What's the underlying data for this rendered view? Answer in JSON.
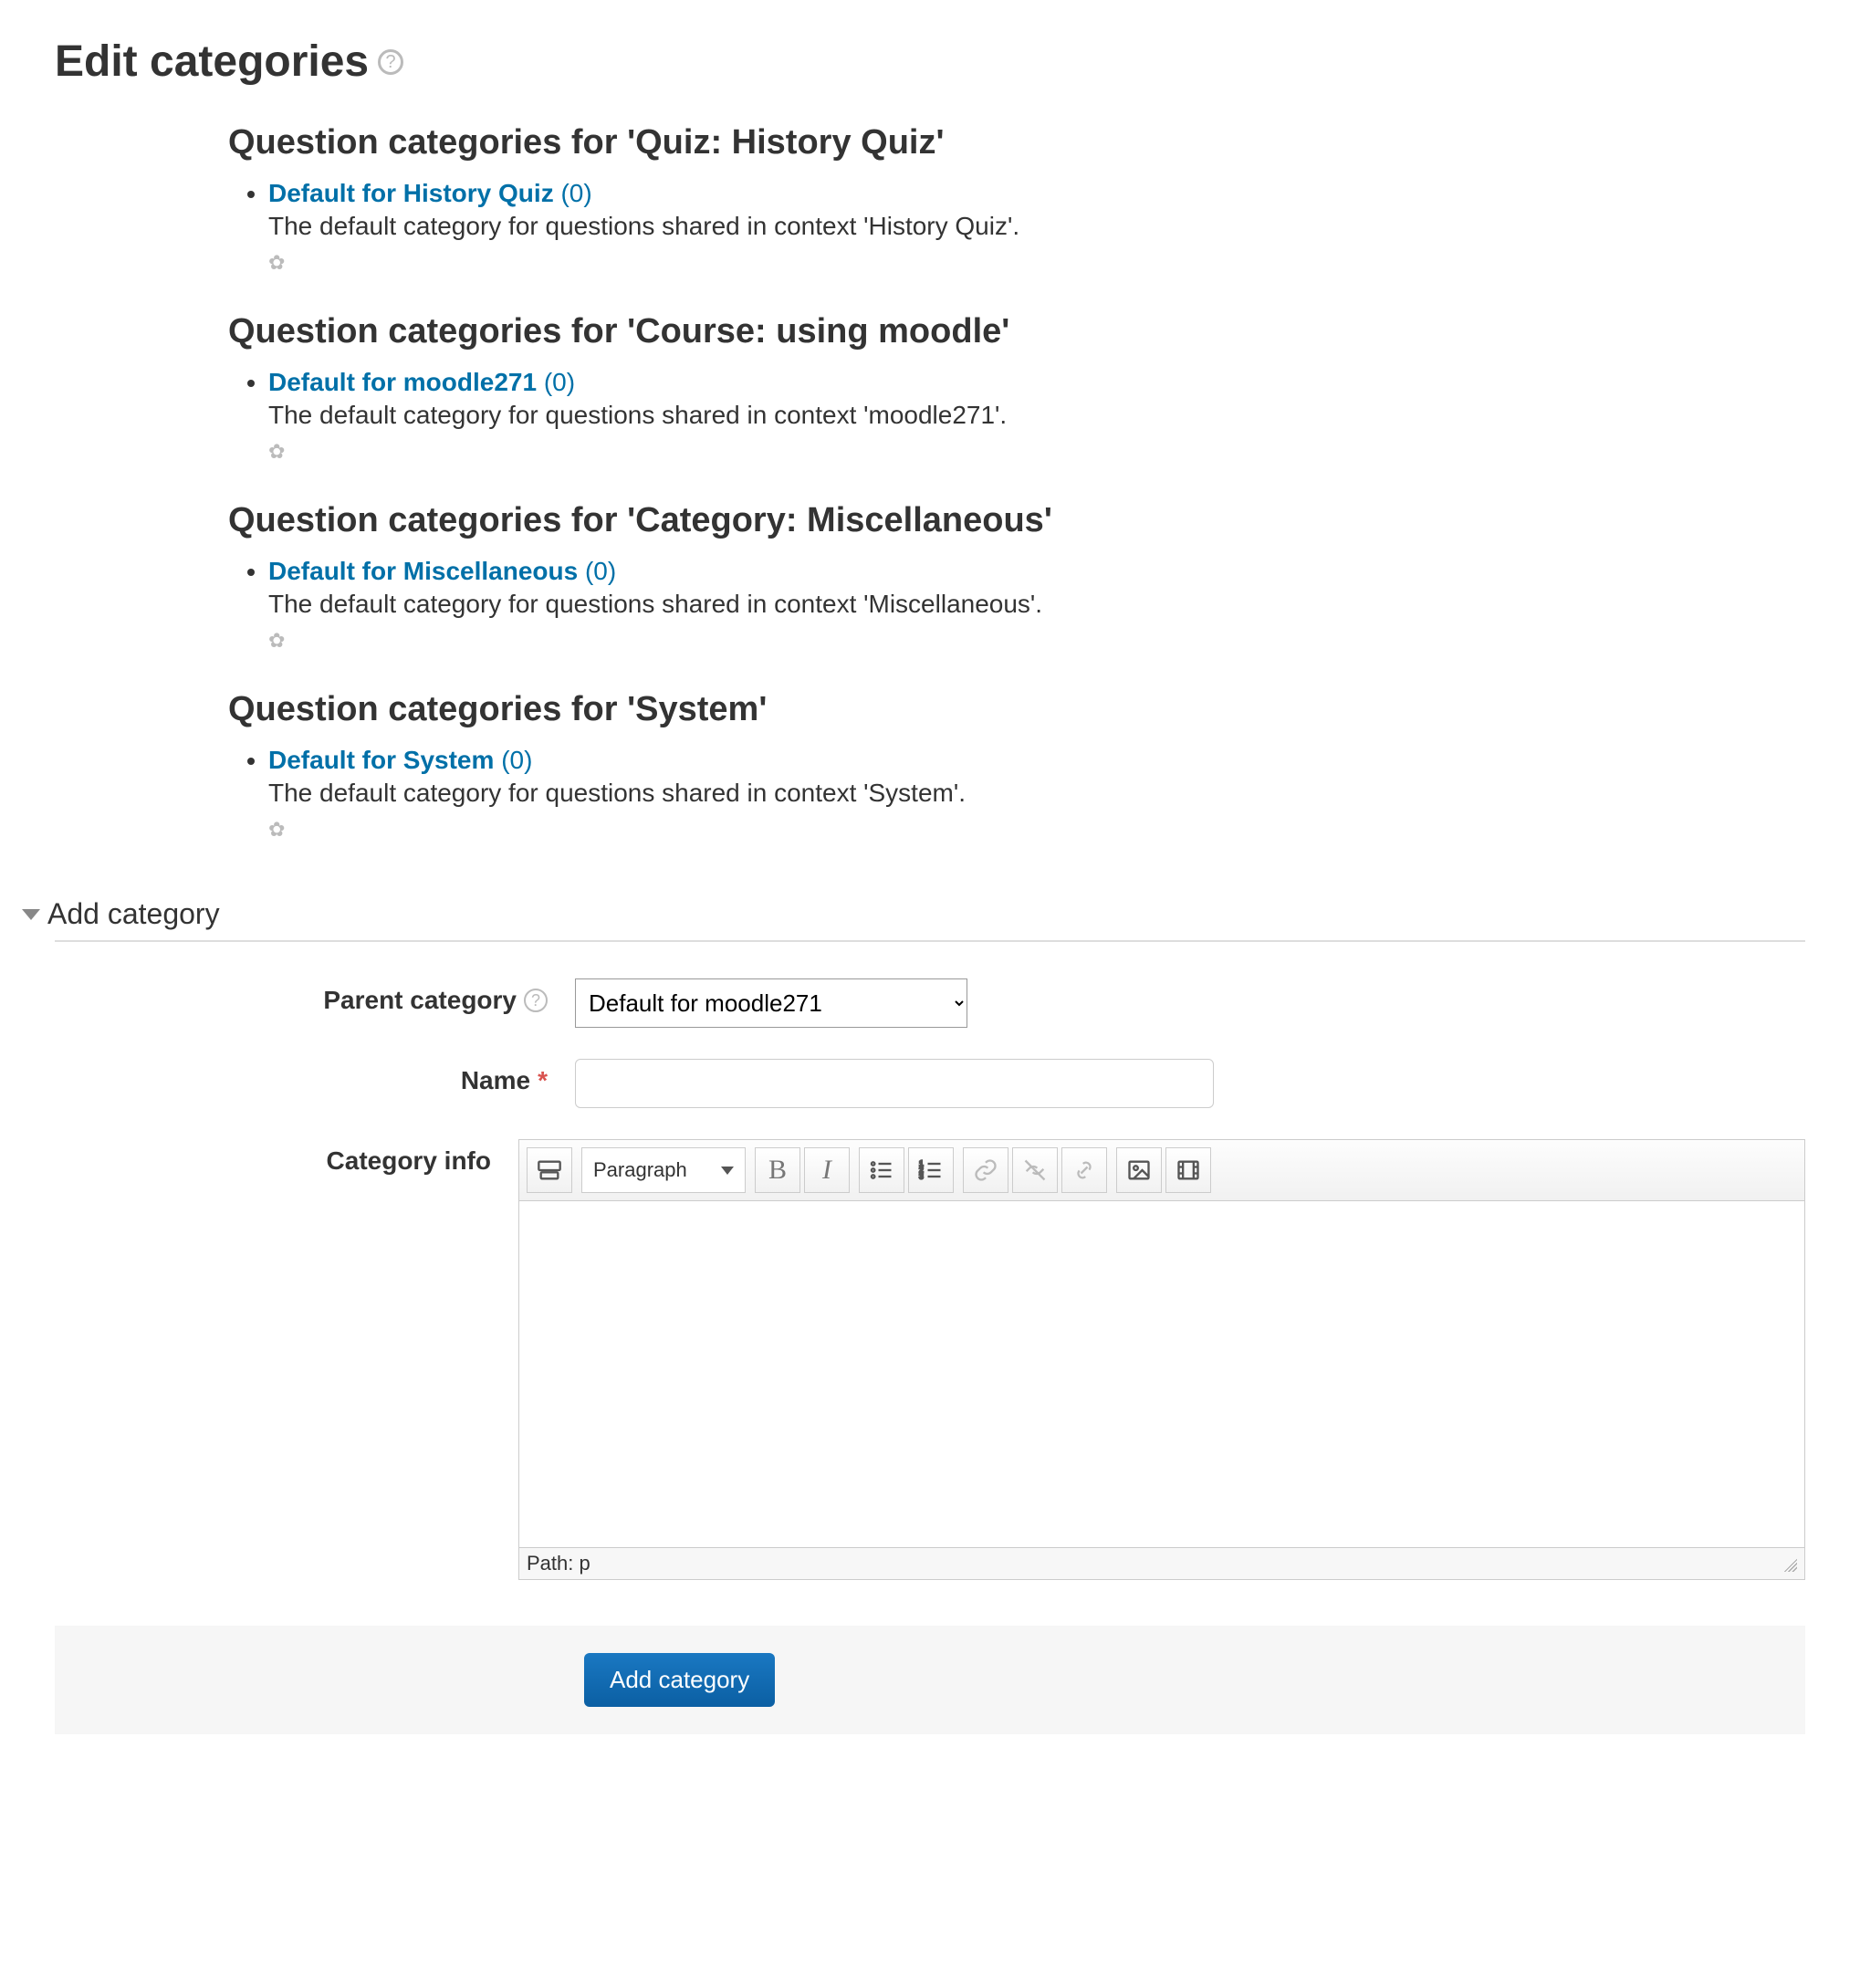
{
  "page": {
    "title": "Edit categories"
  },
  "contexts": [
    {
      "heading": "Question categories for 'Quiz: History Quiz'",
      "link": "Default for History Quiz",
      "count": "(0)",
      "desc": "The default category for questions shared in context 'History Quiz'."
    },
    {
      "heading": "Question categories for 'Course: using moodle'",
      "link": "Default for moodle271",
      "count": "(0)",
      "desc": "The default category for questions shared in context 'moodle271'."
    },
    {
      "heading": "Question categories for 'Category: Miscellaneous'",
      "link": "Default for Miscellaneous",
      "count": "(0)",
      "desc": "The default category for questions shared in context 'Miscellaneous'."
    },
    {
      "heading": "Question categories for 'System'",
      "link": "Default for System",
      "count": "(0)",
      "desc": "The default category for questions shared in context 'System'."
    }
  ],
  "add_section": {
    "title": "Add category"
  },
  "form": {
    "parent_label": "Parent category",
    "parent_value": "Default for moodle271",
    "name_label": "Name",
    "info_label": "Category info",
    "paragraph_label": "Paragraph",
    "path_label": "Path: p",
    "submit_label": "Add category"
  }
}
